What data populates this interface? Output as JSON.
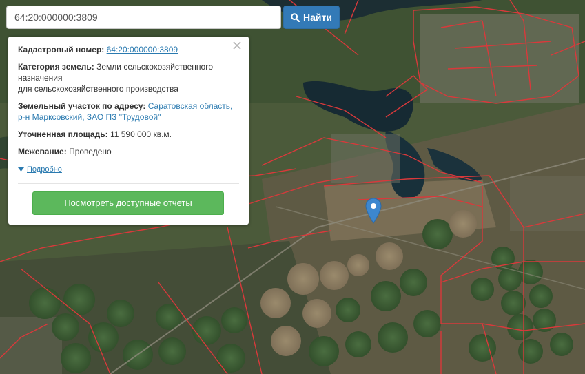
{
  "search": {
    "value": "64:20:000000:3809",
    "button_label": "Найти",
    "icon": "search-icon"
  },
  "popup": {
    "cadastral_label": "Кадастровый номер:",
    "cadastral_value": "64:20:000000:3809",
    "category_label": "Категория земель:",
    "category_line1": "Земли сельскохозяйственного",
    "category_line2": "назначения",
    "category_line3": "для сельскохозяйственного производства",
    "address_label": "Земельный участок по адресу:",
    "address_line1": "Саратовская область,",
    "address_line2": "р-н Марксовский, ЗАО ПЗ \"Трудовой\"",
    "area_label": "Уточненная площадь:",
    "area_value": "11 590 000 кв.м.",
    "survey_label": "Межевание:",
    "survey_value": "Проведено",
    "more_label": "Подробно",
    "report_button": "Посмотреть доступные отчеты",
    "close_icon": "close-icon"
  },
  "map": {
    "marker_icon": "map-marker-icon",
    "marker_color": "#3d87cf",
    "parcel_border_color": "#d9393b",
    "accent_color": "#337ab7",
    "report_button_color": "#5cb85c"
  }
}
